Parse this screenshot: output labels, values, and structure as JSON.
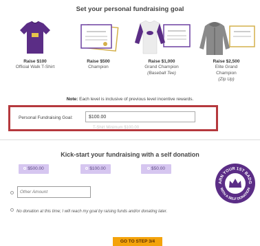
{
  "goal_section": {
    "title": "Set your personal fundraising goal",
    "levels": [
      {
        "raise": "Raise $100",
        "name": "Official Walk T-Shirt",
        "sub": ""
      },
      {
        "raise": "Raise $500",
        "name": "Champion",
        "sub": ""
      },
      {
        "raise": "Raise $1,000",
        "name": "Grand Champion",
        "sub": "(Baseball Tee)"
      },
      {
        "raise": "Raise $2,500",
        "name": "Elite Grand Champion",
        "sub": "(Zip Up)"
      }
    ],
    "note_bold": "Note:",
    "note_text": " Each level is inclusive of previous level incentive rewards.",
    "goal_label": "Personal Fundraising Goal:",
    "goal_value": "$100.00",
    "goal_faint": "T-Shirt Minimum $100.00"
  },
  "donation_section": {
    "title": "Kick-start your fundraising with a self donation",
    "amounts": [
      "$500.00",
      "$100.00",
      "$50.00"
    ],
    "other_placeholder": "Other Amount",
    "no_donation": "No donation at this time; I will reach my goal by raising funds and/or donating later.",
    "badge_top": "EARN YOUR 1ST BADGE",
    "badge_bottom": "WITH A SELF DONATION"
  },
  "footer": {
    "next_button": "GO TO STEP 3/4"
  },
  "colors": {
    "highlight_border": "#b5383d",
    "amount_button": "#d6c6f0",
    "badge": "#5b2d86",
    "cta": "#f4a30b"
  }
}
